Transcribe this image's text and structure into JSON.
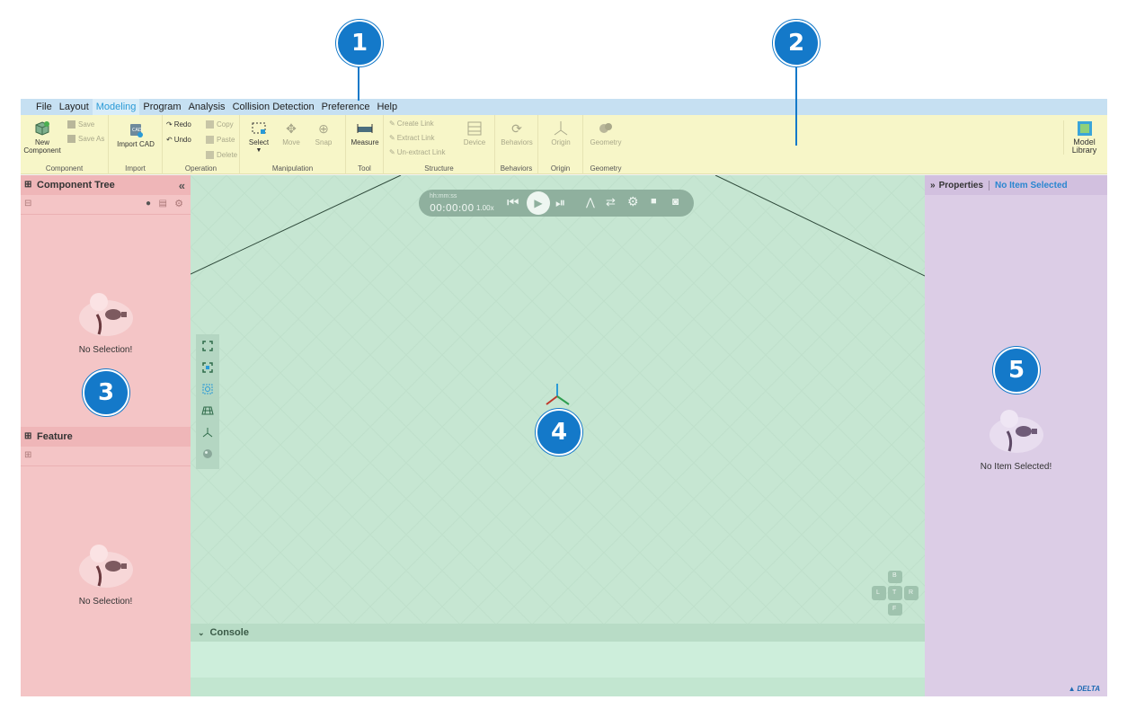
{
  "callouts": [
    "1",
    "2",
    "3",
    "4",
    "5"
  ],
  "menu": [
    "File",
    "Layout",
    "Modeling",
    "Program",
    "Analysis",
    "Collision Detection",
    "Preference",
    "Help"
  ],
  "ribbon": {
    "component": {
      "label": "Component",
      "new_component": "New Component",
      "save": "Save",
      "save_as": "Save As"
    },
    "import": {
      "label": "Import",
      "import_cad": "Import CAD"
    },
    "operation": {
      "label": "Operation",
      "redo": "Redo",
      "undo": "Undo",
      "copy": "Copy",
      "paste": "Paste",
      "delete": "Delete"
    },
    "manipulation": {
      "label": "Manipulation",
      "select": "Select",
      "move": "Move",
      "snap": "Snap"
    },
    "tool": {
      "label": "Tool",
      "measure": "Measure"
    },
    "structure": {
      "label": "Structure",
      "create_link": "Create Link",
      "extract_link": "Extract Link",
      "unextract_link": "Un-extract Link",
      "device": "Device"
    },
    "behaviors": {
      "label": "Behaviors",
      "behaviors": "Behaviors"
    },
    "origin": {
      "label": "Origin",
      "origin": "Origin"
    },
    "geometry": {
      "label": "Geometry",
      "geometry": "Geometry"
    },
    "model_library": "Model Library"
  },
  "left_panel": {
    "component_tree_title": "Component Tree",
    "component_tree_empty": "No Selection!",
    "feature_title": "Feature",
    "feature_empty": "No Selection!"
  },
  "viewport": {
    "time_format": "hh:mm:ss",
    "time": "00:00:00",
    "speed": "1.00x",
    "console_label": "Console",
    "nav_cube": {
      "top": "B",
      "left": "L",
      "center": "T",
      "right": "R",
      "bottom": "F"
    }
  },
  "right_panel": {
    "title": "Properties",
    "selection": "No Item Selected",
    "empty": "No Item Selected!"
  },
  "brand": "DELTA",
  "colors": {
    "callout": "#1479c9",
    "menubar": "#c6e0f2",
    "ribbon": "#f7f6c8",
    "left_panel": "#f4c5c6",
    "viewport": "#c6e6d2",
    "right_panel": "#dccde6",
    "accent": "#2a9ad6"
  }
}
